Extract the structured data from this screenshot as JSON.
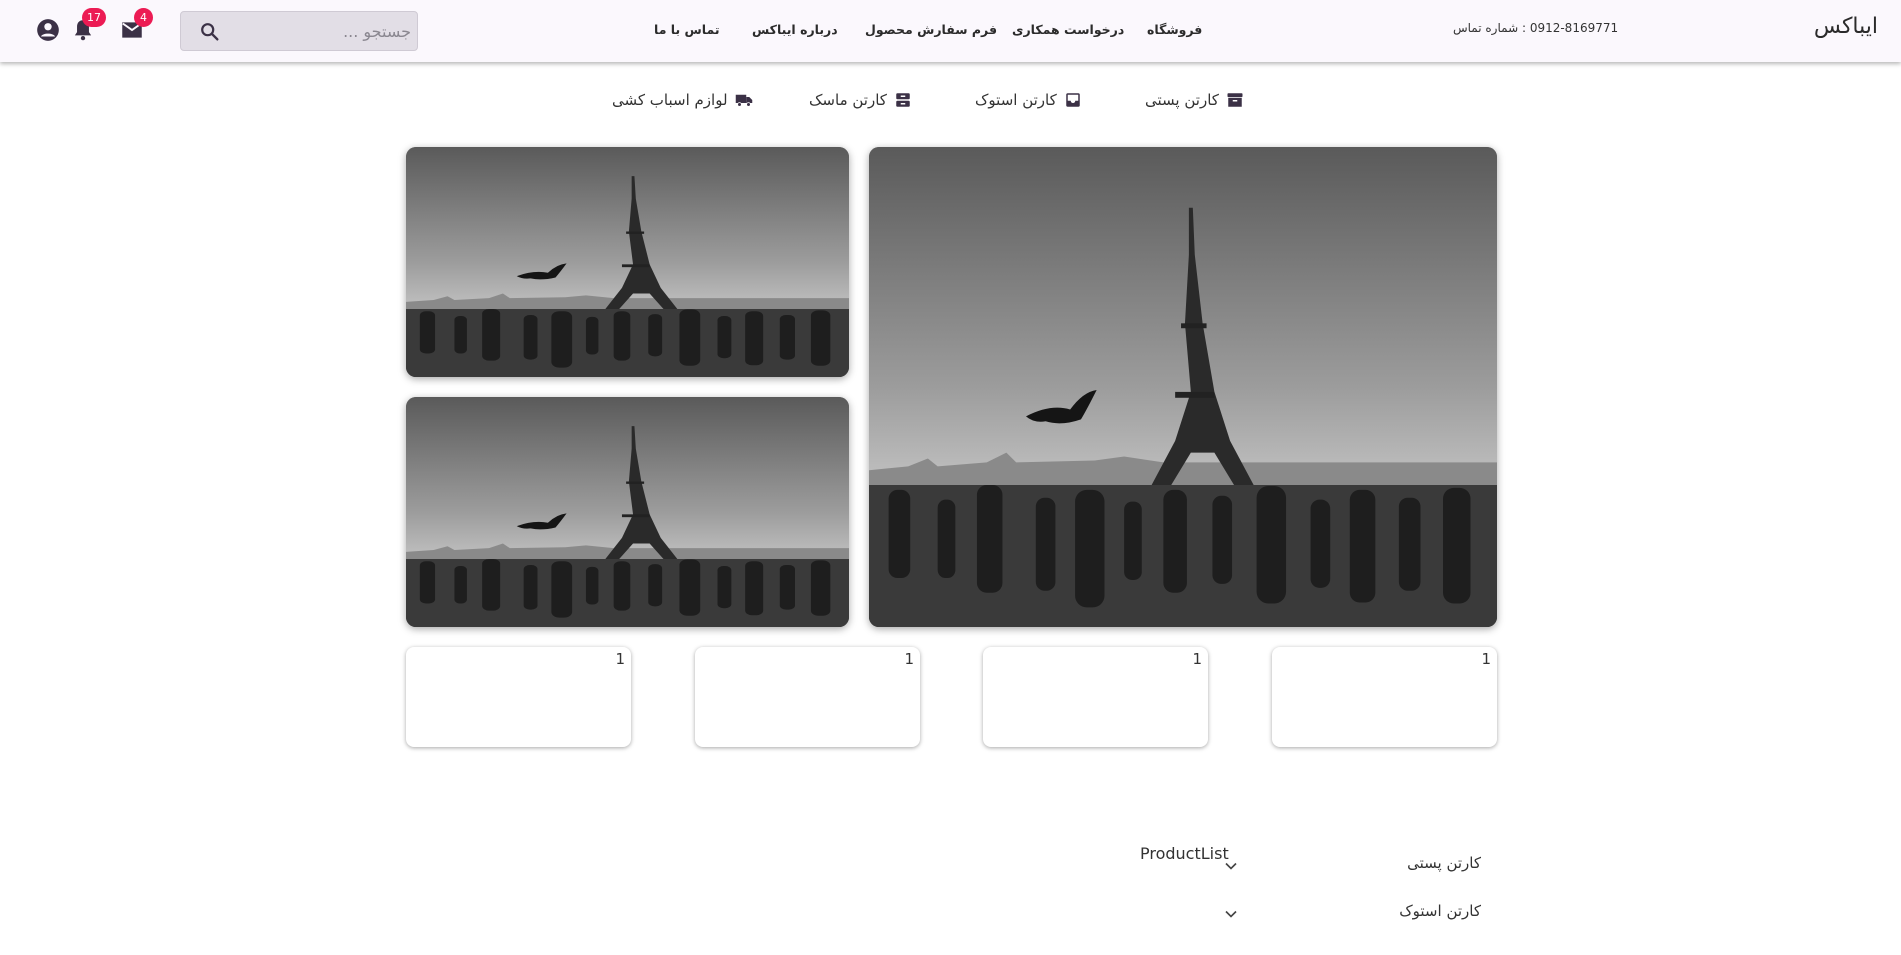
{
  "header": {
    "brand": "ایباکس",
    "phone": "0912-8169771 : شماره تماس",
    "nav": [
      "فروشگاه",
      "درخواست همکاری",
      "فرم سفارش محصول",
      "درباره ایباکس",
      "تماس با ما"
    ],
    "search_placeholder": "جستجو ...",
    "mail_badge": "4",
    "notifications_badge": "17",
    "icons": [
      "search-icon",
      "mail-icon",
      "bell-icon",
      "account-icon"
    ]
  },
  "categories": [
    {
      "label": "کارتن پستی",
      "icon": "archive-icon"
    },
    {
      "label": "کارتن استوک",
      "icon": "inbox-icon"
    },
    {
      "label": "کارتن ماسک",
      "icon": "boxes-icon"
    },
    {
      "label": "لوازم اسباب کشی",
      "icon": "truck-icon"
    }
  ],
  "cards": [
    "1",
    "1",
    "1",
    "1"
  ],
  "product_list": {
    "title": "ProductList",
    "items": [
      "کارتن پستی",
      "کارتن استوک"
    ]
  },
  "colors": {
    "accent": "#ec1b54",
    "topbar": "#fbf8fd",
    "icon": "#3b3146"
  }
}
